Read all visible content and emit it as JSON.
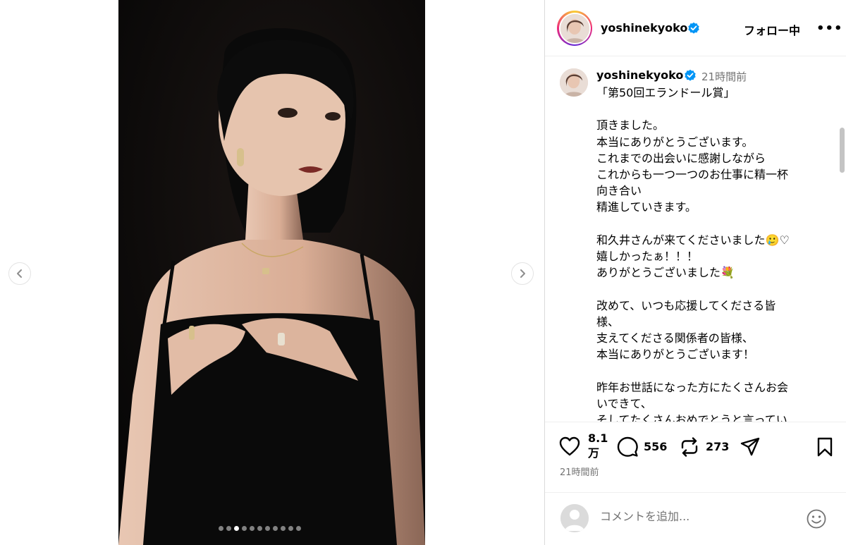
{
  "post": {
    "username": "yoshinekyoko",
    "follow_status": "フォロー中",
    "more_label": "•••",
    "time_relative": "21時間前",
    "caption": "「第50回エランドール賞」\n\n頂きました。\n本当にありがとうございます。\nこれまでの出会いに感謝しながら\nこれからも一つ一つのお仕事に精一杯\n向き合い\n精進していきます。\n\n和久井さんが来てくださいました🥲♡\n嬉しかったぁ！！！\nありがとうございました💐\n\n改めて、いつも応援してくださる皆\n様、\n支えてくださる関係者の皆様、\n本当にありがとうございます！\n\n昨年お世話になった方にたくさんお会\nいできて、\nそしてたくさんおめでとうと言ってい",
    "likes": "8.1万",
    "likes_line1": "8.1",
    "likes_line2": "万",
    "comments": "556",
    "reposts": "273",
    "timestamp": "21時間前"
  },
  "carousel": {
    "total_slides": 11,
    "active_index": 2
  },
  "comment_box": {
    "placeholder": "コメントを追加..."
  },
  "icons": {
    "prev": "chevron-left-icon",
    "next": "chevron-right-icon",
    "verified": "verified-badge-icon",
    "like": "heart-icon",
    "comment": "comment-bubble-icon",
    "repost": "repost-icon",
    "share": "paper-plane-icon",
    "save": "bookmark-icon",
    "emoji": "emoji-icon"
  },
  "colors": {
    "verified": "#0095f6",
    "secondary_text": "#737373",
    "border": "#dbdbdb"
  }
}
